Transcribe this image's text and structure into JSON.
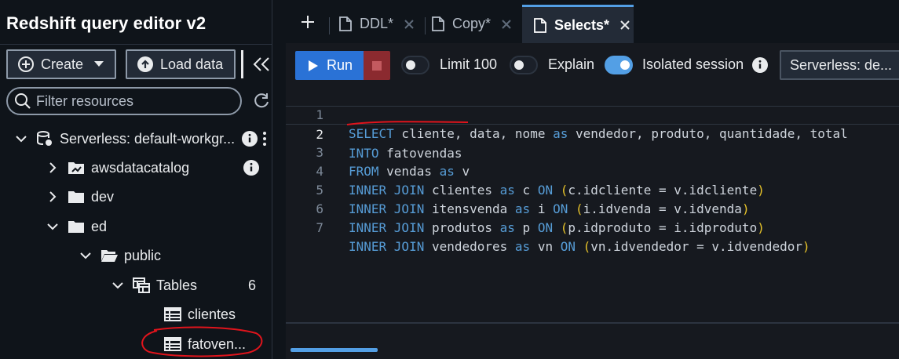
{
  "app": {
    "title": "Redshift query editor v2"
  },
  "sidebar": {
    "create_label": "Create",
    "load_label": "Load data",
    "filter_placeholder": "Filter resources",
    "tree": {
      "workgroup": "Serverless: default-workgr...",
      "catalog": "awsdatacatalog",
      "db_dev": "dev",
      "db_ed": "ed",
      "schema": "public",
      "tables_label": "Tables",
      "tables_count": "6",
      "tables": [
        "clientes",
        "fatoven..."
      ]
    }
  },
  "tabs": [
    {
      "label": "DDL*",
      "active": false
    },
    {
      "label": "Copy*",
      "active": false
    },
    {
      "label": "Selects*",
      "active": true
    }
  ],
  "toolbar": {
    "run_label": "Run",
    "limit_label": "Limit 100",
    "limit_on": false,
    "explain_label": "Explain",
    "explain_on": false,
    "isolated_label": "Isolated session",
    "isolated_on": true,
    "workgroup_select": "Serverless: de..."
  },
  "editor": {
    "current_line": 2,
    "lines": [
      {
        "n": "1",
        "text": "SELECT cliente, data, nome as vendedor, produto, quantidade, total"
      },
      {
        "n": "2",
        "text": "INTO fatovendas"
      },
      {
        "n": "3",
        "text": "FROM vendas as v"
      },
      {
        "n": "4",
        "text": "INNER JOIN clientes as c ON (c.idcliente = v.idcliente)"
      },
      {
        "n": "5",
        "text": "INNER JOIN itensvenda as i ON (i.idvenda = v.idvenda)"
      },
      {
        "n": "6",
        "text": "INNER JOIN produtos as p ON (p.idproduto = i.idproduto)"
      },
      {
        "n": "7",
        "text": "INNER JOIN vendedores as vn ON (vn.idvendedor = v.idvendedor)"
      }
    ]
  },
  "colors": {
    "accent": "#539fe5",
    "run": "#2a72d6",
    "keyword": "#569cd6",
    "annotation": "#e0141c"
  }
}
